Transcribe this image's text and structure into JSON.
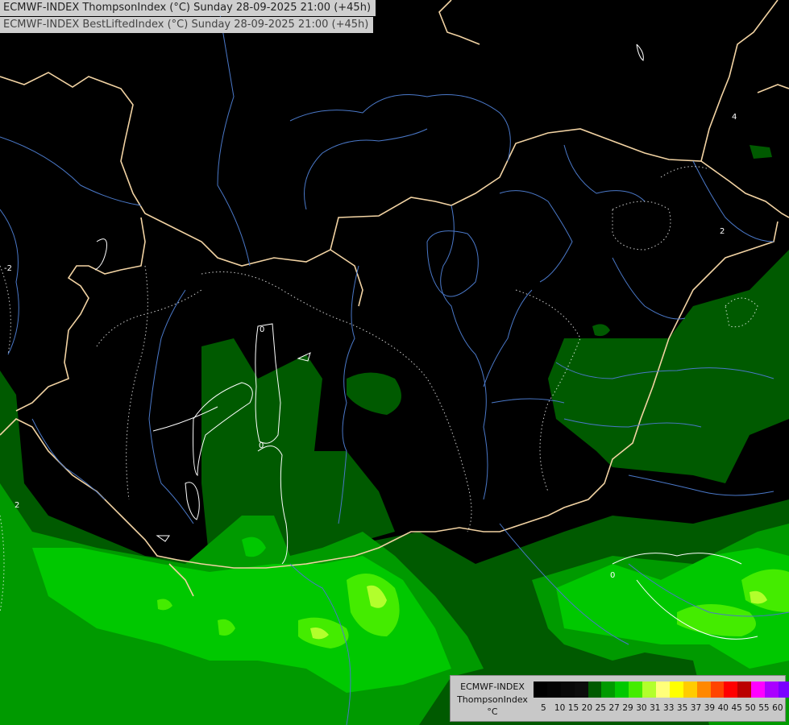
{
  "title": {
    "line1": "ECMWF-INDEX ThompsonIndex (°C) Sunday 28-09-2025 21:00 (+45h)",
    "line2": "ECMWF-INDEX BestLiftedIndex (°C) Sunday 28-09-2025 21:00 (+45h)"
  },
  "legend": {
    "model": "ECMWF-INDEX",
    "parameter": "ThompsonIndex",
    "unit": "°C",
    "colors": [
      "#000000",
      "#040404",
      "#080808",
      "#0c0c0c",
      "#005a00",
      "#009a00",
      "#00c800",
      "#44ec00",
      "#b2ff2c",
      "#ffff7a",
      "#ffff00",
      "#ffcc00",
      "#ff8800",
      "#ff4400",
      "#ff0000",
      "#bb0000",
      "#ff00ff",
      "#aa00ff",
      "#7a00ff",
      "#5500ff",
      "#0000ff"
    ],
    "ticks": [
      "5",
      "10",
      "15",
      "20",
      "25",
      "27",
      "29",
      "30",
      "31",
      "33",
      "35",
      "37",
      "39",
      "40",
      "45",
      "50",
      "55",
      "60"
    ]
  },
  "contour_labels": [
    "4",
    "2",
    "2",
    "0",
    "0",
    "0",
    "-2"
  ]
}
